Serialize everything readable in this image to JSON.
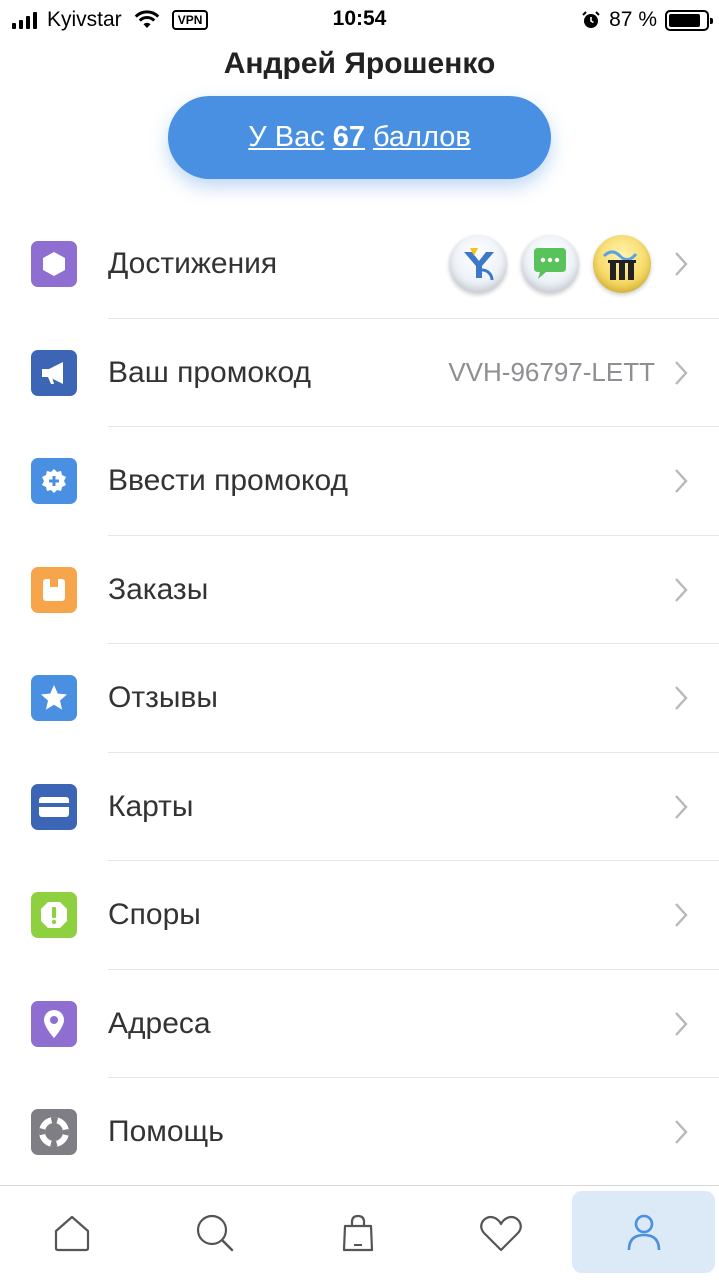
{
  "status_bar": {
    "carrier": "Kyivstar",
    "vpn": "VPN",
    "time": "10:54",
    "battery": "87 %"
  },
  "profile": {
    "name": "Андрей Ярошенко",
    "points_prefix": "У Вас",
    "points_value": "67",
    "points_suffix": "баллов"
  },
  "menu": [
    {
      "label": "Достижения",
      "icon": "hexagon-icon",
      "color": "#8e6ed1"
    },
    {
      "label": "Ваш промокод",
      "value": "VVH-96797-LETT",
      "icon": "megaphone-icon",
      "color": "#3c66b5"
    },
    {
      "label": "Ввести промокод",
      "icon": "gear-plus-icon",
      "color": "#4a90e2"
    },
    {
      "label": "Заказы",
      "icon": "box-icon",
      "color": "#f6a54a"
    },
    {
      "label": "Отзывы",
      "icon": "star-icon",
      "color": "#4a90e2"
    },
    {
      "label": "Карты",
      "icon": "card-icon",
      "color": "#3c66b5"
    },
    {
      "label": "Споры",
      "icon": "alert-icon",
      "color": "#8ed040"
    },
    {
      "label": "Адреса",
      "icon": "pin-icon",
      "color": "#8e6ed1"
    },
    {
      "label": "Помощь",
      "icon": "lifebuoy-icon",
      "color": "#7e7e84"
    }
  ],
  "tabs": [
    {
      "name": "home-icon",
      "active": false
    },
    {
      "name": "search-icon",
      "active": false
    },
    {
      "name": "bag-icon",
      "active": false
    },
    {
      "name": "heart-icon",
      "active": false
    },
    {
      "name": "user-icon",
      "active": true
    }
  ],
  "colors": {
    "accent": "#4a90e2",
    "active_tab_bg": "#dce9f7"
  }
}
